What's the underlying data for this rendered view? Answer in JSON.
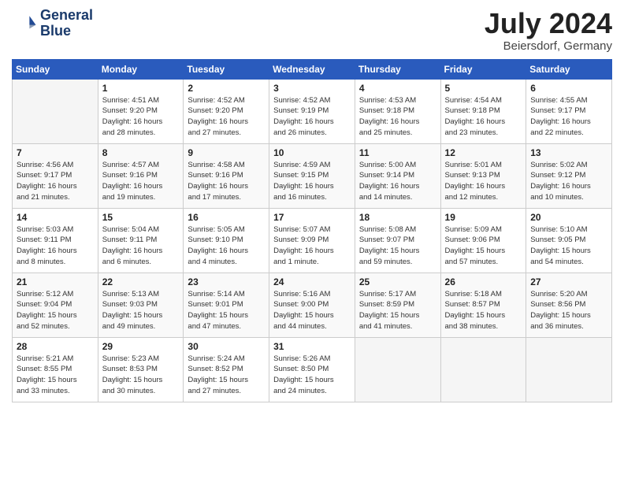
{
  "logo": {
    "line1": "General",
    "line2": "Blue"
  },
  "title": "July 2024",
  "subtitle": "Beiersdorf, Germany",
  "header_days": [
    "Sunday",
    "Monday",
    "Tuesday",
    "Wednesday",
    "Thursday",
    "Friday",
    "Saturday"
  ],
  "weeks": [
    [
      {
        "day": "",
        "info": ""
      },
      {
        "day": "1",
        "info": "Sunrise: 4:51 AM\nSunset: 9:20 PM\nDaylight: 16 hours\nand 28 minutes."
      },
      {
        "day": "2",
        "info": "Sunrise: 4:52 AM\nSunset: 9:20 PM\nDaylight: 16 hours\nand 27 minutes."
      },
      {
        "day": "3",
        "info": "Sunrise: 4:52 AM\nSunset: 9:19 PM\nDaylight: 16 hours\nand 26 minutes."
      },
      {
        "day": "4",
        "info": "Sunrise: 4:53 AM\nSunset: 9:18 PM\nDaylight: 16 hours\nand 25 minutes."
      },
      {
        "day": "5",
        "info": "Sunrise: 4:54 AM\nSunset: 9:18 PM\nDaylight: 16 hours\nand 23 minutes."
      },
      {
        "day": "6",
        "info": "Sunrise: 4:55 AM\nSunset: 9:17 PM\nDaylight: 16 hours\nand 22 minutes."
      }
    ],
    [
      {
        "day": "7",
        "info": "Sunrise: 4:56 AM\nSunset: 9:17 PM\nDaylight: 16 hours\nand 21 minutes."
      },
      {
        "day": "8",
        "info": "Sunrise: 4:57 AM\nSunset: 9:16 PM\nDaylight: 16 hours\nand 19 minutes."
      },
      {
        "day": "9",
        "info": "Sunrise: 4:58 AM\nSunset: 9:16 PM\nDaylight: 16 hours\nand 17 minutes."
      },
      {
        "day": "10",
        "info": "Sunrise: 4:59 AM\nSunset: 9:15 PM\nDaylight: 16 hours\nand 16 minutes."
      },
      {
        "day": "11",
        "info": "Sunrise: 5:00 AM\nSunset: 9:14 PM\nDaylight: 16 hours\nand 14 minutes."
      },
      {
        "day": "12",
        "info": "Sunrise: 5:01 AM\nSunset: 9:13 PM\nDaylight: 16 hours\nand 12 minutes."
      },
      {
        "day": "13",
        "info": "Sunrise: 5:02 AM\nSunset: 9:12 PM\nDaylight: 16 hours\nand 10 minutes."
      }
    ],
    [
      {
        "day": "14",
        "info": "Sunrise: 5:03 AM\nSunset: 9:11 PM\nDaylight: 16 hours\nand 8 minutes."
      },
      {
        "day": "15",
        "info": "Sunrise: 5:04 AM\nSunset: 9:11 PM\nDaylight: 16 hours\nand 6 minutes."
      },
      {
        "day": "16",
        "info": "Sunrise: 5:05 AM\nSunset: 9:10 PM\nDaylight: 16 hours\nand 4 minutes."
      },
      {
        "day": "17",
        "info": "Sunrise: 5:07 AM\nSunset: 9:09 PM\nDaylight: 16 hours\nand 1 minute."
      },
      {
        "day": "18",
        "info": "Sunrise: 5:08 AM\nSunset: 9:07 PM\nDaylight: 15 hours\nand 59 minutes."
      },
      {
        "day": "19",
        "info": "Sunrise: 5:09 AM\nSunset: 9:06 PM\nDaylight: 15 hours\nand 57 minutes."
      },
      {
        "day": "20",
        "info": "Sunrise: 5:10 AM\nSunset: 9:05 PM\nDaylight: 15 hours\nand 54 minutes."
      }
    ],
    [
      {
        "day": "21",
        "info": "Sunrise: 5:12 AM\nSunset: 9:04 PM\nDaylight: 15 hours\nand 52 minutes."
      },
      {
        "day": "22",
        "info": "Sunrise: 5:13 AM\nSunset: 9:03 PM\nDaylight: 15 hours\nand 49 minutes."
      },
      {
        "day": "23",
        "info": "Sunrise: 5:14 AM\nSunset: 9:01 PM\nDaylight: 15 hours\nand 47 minutes."
      },
      {
        "day": "24",
        "info": "Sunrise: 5:16 AM\nSunset: 9:00 PM\nDaylight: 15 hours\nand 44 minutes."
      },
      {
        "day": "25",
        "info": "Sunrise: 5:17 AM\nSunset: 8:59 PM\nDaylight: 15 hours\nand 41 minutes."
      },
      {
        "day": "26",
        "info": "Sunrise: 5:18 AM\nSunset: 8:57 PM\nDaylight: 15 hours\nand 38 minutes."
      },
      {
        "day": "27",
        "info": "Sunrise: 5:20 AM\nSunset: 8:56 PM\nDaylight: 15 hours\nand 36 minutes."
      }
    ],
    [
      {
        "day": "28",
        "info": "Sunrise: 5:21 AM\nSunset: 8:55 PM\nDaylight: 15 hours\nand 33 minutes."
      },
      {
        "day": "29",
        "info": "Sunrise: 5:23 AM\nSunset: 8:53 PM\nDaylight: 15 hours\nand 30 minutes."
      },
      {
        "day": "30",
        "info": "Sunrise: 5:24 AM\nSunset: 8:52 PM\nDaylight: 15 hours\nand 27 minutes."
      },
      {
        "day": "31",
        "info": "Sunrise: 5:26 AM\nSunset: 8:50 PM\nDaylight: 15 hours\nand 24 minutes."
      },
      {
        "day": "",
        "info": ""
      },
      {
        "day": "",
        "info": ""
      },
      {
        "day": "",
        "info": ""
      }
    ]
  ]
}
